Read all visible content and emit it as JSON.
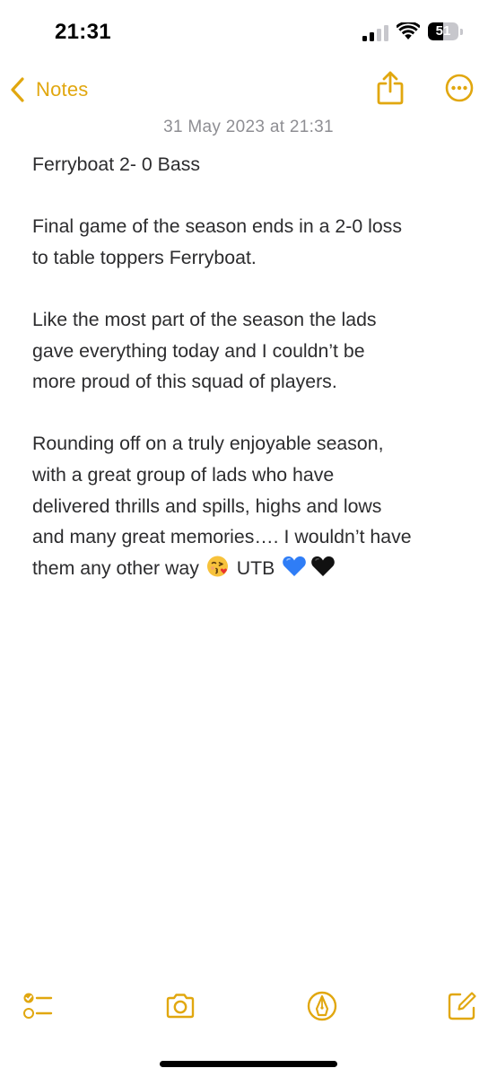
{
  "status_bar": {
    "time": "21:31",
    "battery_level": "51",
    "signal_bars_active": 2,
    "signal_bars_total": 4
  },
  "nav": {
    "back_label": "Notes",
    "share_icon": "share-icon",
    "more_icon": "more-icon"
  },
  "note": {
    "date": "31 May 2023 at 21:31",
    "title": "Ferryboat 2- 0 Bass",
    "paragraphs": [
      "Final game of the season ends in a 2-0 loss\nto table toppers Ferryboat.",
      "Like the most part of the season the lads\ngave everything today and I couldn’t be\nmore proud of this squad of players.",
      "Rounding off on a truly enjoyable season,\nwith a great group of lads who have\ndelivered thrills and spills, highs and lows\nand many great memories…. I wouldn’t have\nthem any other way"
    ],
    "closing_text": "UTB",
    "emojis": [
      "kissing-face-heart-emoji",
      "blue-heart-emoji",
      "black-heart-emoji"
    ]
  },
  "toolbar": {
    "icons": [
      "checklist-icon",
      "camera-icon",
      "markup-icon",
      "compose-icon"
    ]
  },
  "colors": {
    "accent": "#e1a70f",
    "date_text": "#8e8e93",
    "body_text": "#2c2c2e",
    "background": "#ffffff"
  }
}
